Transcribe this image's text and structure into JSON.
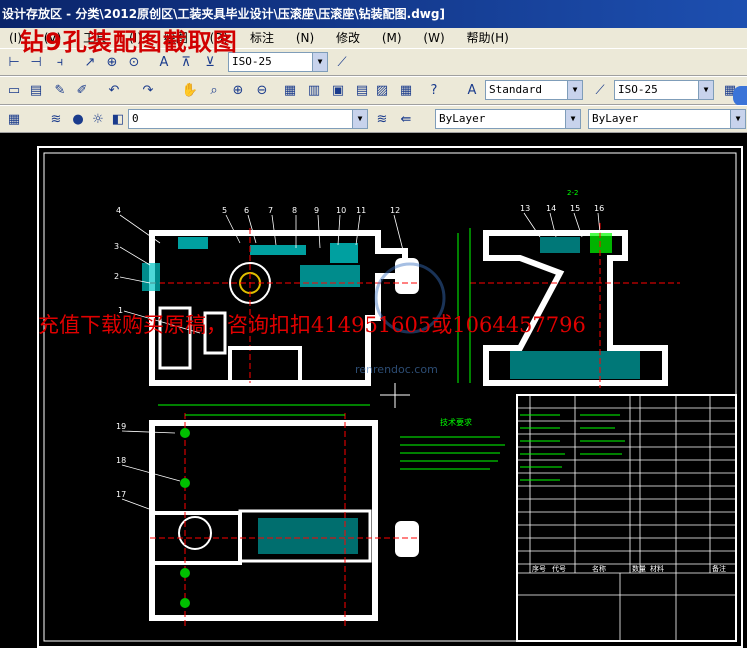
{
  "window": {
    "title": "设计存放区 - 分类\\2012原创区\\工装夹具毕业设计\\压滚座\\压滚座\\钻装配图.dwg]"
  },
  "menubar": {
    "items": [
      "(I)",
      "(V)",
      "工具",
      "(I)",
      "绘图",
      "(D)",
      "标注",
      "(N)",
      "修改",
      "(M)",
      "(W)",
      "帮助(H)"
    ]
  },
  "toolbar1": {
    "dimstyle": "ISO-25"
  },
  "toolbar2": {
    "textstyle": "Standard",
    "dimstyle": "ISO-25"
  },
  "toolbar3": {
    "layer": "0",
    "color": "ByLayer",
    "linetype": "ByLayer"
  },
  "watermarks": {
    "top": "钻9孔装配图截取图",
    "middle": "充值下载购买原稿，咨询扣扣414951605或1064457796"
  },
  "drawing": {
    "balloons_top_left": [
      "4",
      "5",
      "6",
      "7",
      "8",
      "9",
      "10",
      "11",
      "12",
      "3",
      "2",
      "1"
    ],
    "balloons_top_right": [
      "13",
      "14",
      "15",
      "16"
    ],
    "balloons_bottom_left": [
      "19",
      "18",
      "17"
    ],
    "notes_title": "技术要求",
    "website": "renrendoc.com",
    "title_block": {
      "col_labels": [
        "序号",
        "代号",
        "名称",
        "数量",
        "材料",
        "备注"
      ]
    }
  },
  "colors": {
    "background": "#000000",
    "outline": "#ffffff",
    "hatch": "#00c8c8",
    "dim": "#00ff00",
    "center": "#ff0000",
    "balloon": "#ffffff",
    "watermark": "#e00000"
  }
}
